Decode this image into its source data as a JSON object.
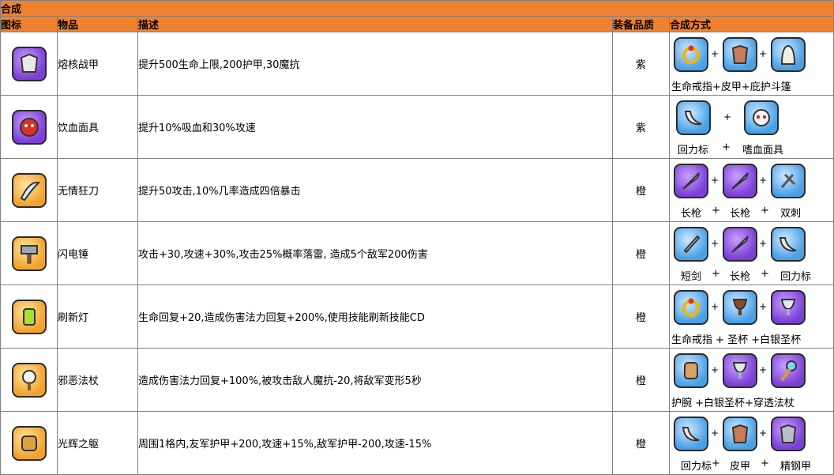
{
  "sheet": {
    "title": "合成",
    "headers": {
      "icon": "图标",
      "item": "物品",
      "desc": "描述",
      "quality": "装备品质",
      "recipe": "合成方式"
    }
  },
  "rows": [
    {
      "icon_name": "molten-armor-icon",
      "color": "purple",
      "name": "熔核战甲",
      "desc": "提升500生命上限,200护甲,30魔抗",
      "quality": "紫",
      "recipe_icons": [
        "ring-of-life-icon",
        "leather-armor-icon",
        "protective-cloak-icon"
      ],
      "recipe_text": [
        "生命戒指+皮甲+庇护斗篷"
      ]
    },
    {
      "icon_name": "blood-mask-icon",
      "color": "purple",
      "name": "饮血面具",
      "desc": "提升10%吸血和30%攻速",
      "quality": "紫",
      "recipe_icons": [
        "boomerang-icon",
        "bloodthirst-mask-icon"
      ],
      "recipe_text": [
        "回力标",
        "+",
        "嗜血面具"
      ]
    },
    {
      "icon_name": "ruthless-blade-icon",
      "color": "orange",
      "name": "无情狂刀",
      "desc": "提升50攻击,10%几率造成四倍暴击",
      "quality": "橙",
      "recipe_icons": [
        "spear-icon",
        "spear-icon",
        "double-thorn-icon"
      ],
      "recipe_text": [
        "长枪",
        "+",
        "长枪",
        "+",
        "双刺"
      ]
    },
    {
      "icon_name": "lightning-hammer-icon",
      "color": "orange",
      "name": "闪电锤",
      "desc": "攻击+30,攻速+30%,攻击25%概率落雷, 造成5个敌军200伤害",
      "quality": "橙",
      "recipe_icons": [
        "short-sword-icon",
        "spear-icon",
        "boomerang-icon"
      ],
      "recipe_text": [
        "短剑",
        "+",
        "长枪",
        "+",
        "回力标"
      ]
    },
    {
      "icon_name": "refresh-lamp-icon",
      "color": "orange",
      "name": "刷新灯",
      "desc": "生命回复+20,造成伤害法力回复+200%,使用技能刷新技能CD",
      "quality": "橙",
      "recipe_icons": [
        "ring-of-life-icon",
        "holy-cup-icon",
        "silver-grail-icon"
      ],
      "recipe_text": [
        "生命戒指 + 圣杯 +白银圣杯"
      ]
    },
    {
      "icon_name": "evil-staff-icon",
      "color": "orange",
      "name": "邪恶法杖",
      "desc": "造成伤害法力回复+100%,被攻击敌人魔抗-20,将敌军变形5秒",
      "quality": "橙",
      "recipe_icons": [
        "bracer-icon",
        "silver-grail-icon",
        "piercing-staff-icon"
      ],
      "recipe_text": [
        "护腕 +白银圣杯+穿透法杖"
      ]
    },
    {
      "icon_name": "radiant-body-icon",
      "color": "orange",
      "name": "光辉之躯",
      "desc": "周围1格内,友军护甲+200,攻速+15%,敌军护甲-200,攻速-15%",
      "quality": "橙",
      "recipe_icons": [
        "boomerang-icon",
        "leather-armor-icon",
        "fine-steel-armor-icon"
      ],
      "recipe_text": [
        "回力标",
        "+",
        "皮甲",
        "+",
        "精钢甲"
      ]
    }
  ],
  "plus_sign": "+",
  "colors": {
    "header": "#f0822f",
    "grid": "#7f7f7f"
  }
}
